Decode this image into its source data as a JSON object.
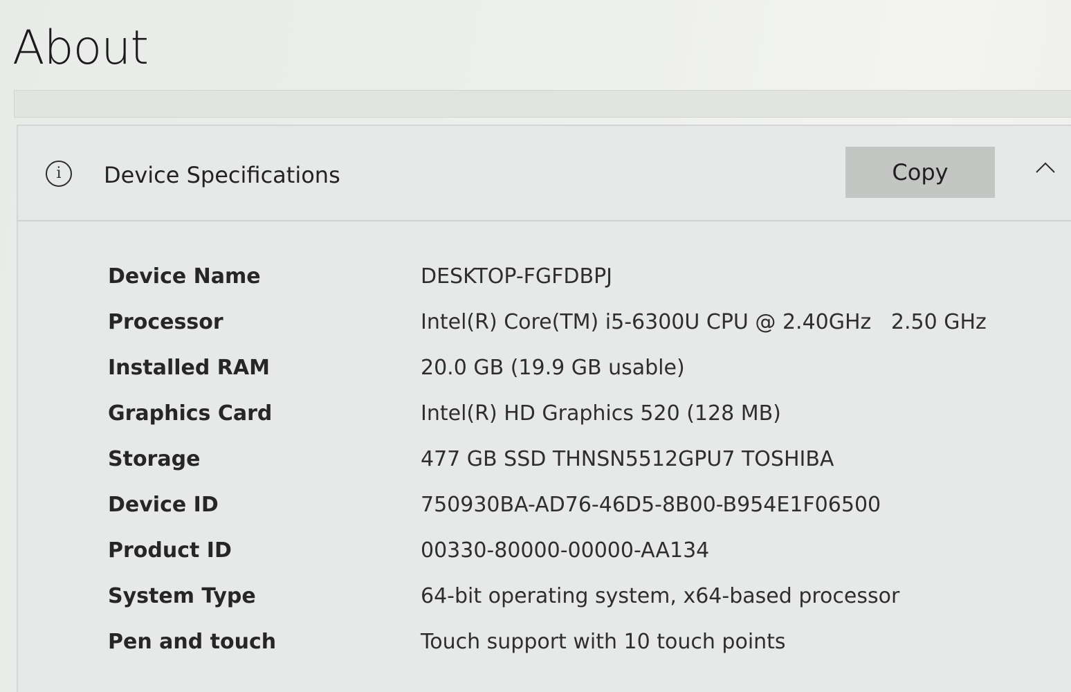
{
  "page": {
    "title": "About"
  },
  "device_specifications": {
    "title": "Device Specifications",
    "copy_label": "Copy",
    "icon": "info-icon",
    "collapse_icon": "chevron-up-icon",
    "rows": [
      {
        "label": "Device Name",
        "value": "DESKTOP-FGFDBPJ"
      },
      {
        "label": "Processor",
        "value": "Intel(R) Core(TM) i5-6300U CPU @ 2.40GHz   2.50 GHz"
      },
      {
        "label": "Installed RAM",
        "value": "20.0 GB (19.9 GB usable)"
      },
      {
        "label": "Graphics Card",
        "value": "Intel(R) HD Graphics 520 (128 MB)"
      },
      {
        "label": "Storage",
        "value": "477 GB SSD THNSN5512GPU7 TOSHIBA"
      },
      {
        "label": "Device ID",
        "value": "750930BA-AD76-46D5-8B00-B954E1F06500"
      },
      {
        "label": "Product ID",
        "value": "00330-80000-00000-AA134"
      },
      {
        "label": "System Type",
        "value": "64-bit operating system, x64-based processor"
      },
      {
        "label": "Pen and touch",
        "value": "Touch support with 10 touch points"
      }
    ]
  }
}
